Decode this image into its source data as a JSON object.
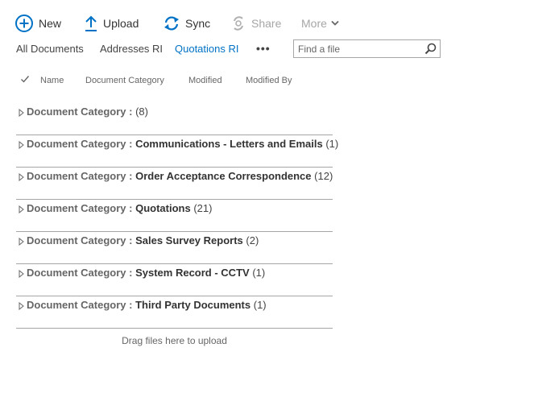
{
  "toolbar": {
    "new_label": "New",
    "upload_label": "Upload",
    "sync_label": "Sync",
    "share_label": "Share",
    "more_label": "More",
    "icons": {
      "new": "plus-circle-icon",
      "upload": "upload-arrow-icon",
      "sync": "sync-icon",
      "share": "share-icon",
      "more": "chevron-down-icon"
    }
  },
  "views": {
    "items": [
      "All Documents",
      "Addresses RI",
      "Quotations RI"
    ],
    "active": "Quotations RI",
    "more": "•••"
  },
  "search": {
    "placeholder": "Find a file",
    "value": ""
  },
  "columns": {
    "check": "✓",
    "headers": [
      "Name",
      "Document Category",
      "Modified",
      "Modified By"
    ]
  },
  "groups": [
    {
      "field": "Document Category",
      "sep": " : ",
      "value": "",
      "count": "(8)"
    },
    {
      "field": "Document Category",
      "sep": " : ",
      "value": "Communications - Letters and Emails",
      "count": "(1)"
    },
    {
      "field": "Document Category",
      "sep": " : ",
      "value": "Order Acceptance Correspondence",
      "count": "(12)"
    },
    {
      "field": "Document Category",
      "sep": " : ",
      "value": "Quotations",
      "count": "(21)"
    },
    {
      "field": "Document Category",
      "sep": " : ",
      "value": "Sales Survey Reports",
      "count": "(2)"
    },
    {
      "field": "Document Category",
      "sep": " : ",
      "value": "System Record - CCTV",
      "count": "(1)"
    },
    {
      "field": "Document Category",
      "sep": " : ",
      "value": "Third Party Documents",
      "count": "(1)"
    }
  ],
  "drop_hint": "Drag files here to upload",
  "colors": {
    "accent": "#0072c6",
    "disabled": "#a6a6a6",
    "divider": "#a6a6a6"
  }
}
